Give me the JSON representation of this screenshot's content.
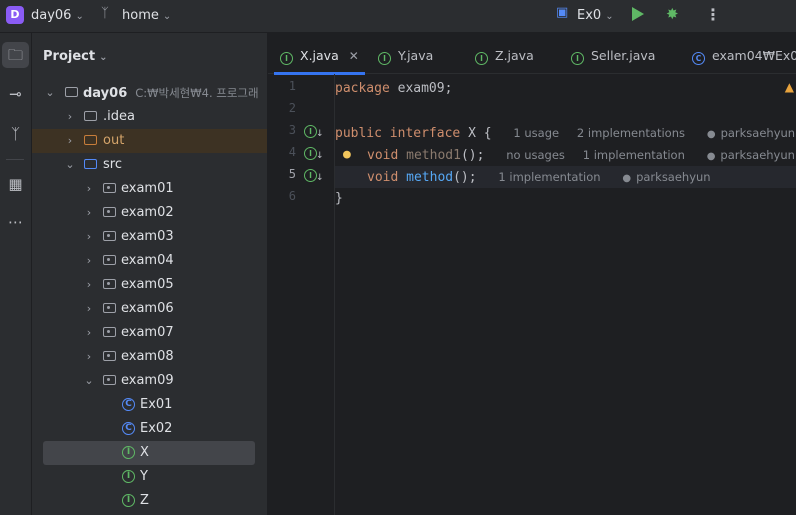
{
  "titlebar": {
    "project_badge": "D",
    "project_name": "day06",
    "branch": "home",
    "run_config": "Ex0"
  },
  "project_panel": {
    "title": "Project",
    "root": {
      "label": "day06",
      "path": "C:₩박세현₩4. 프로그래"
    },
    "items": [
      {
        "label": ".idea"
      },
      {
        "label": "out"
      },
      {
        "label": "src"
      },
      {
        "label": "exam01"
      },
      {
        "label": "exam02"
      },
      {
        "label": "exam03"
      },
      {
        "label": "exam04"
      },
      {
        "label": "exam05"
      },
      {
        "label": "exam06"
      },
      {
        "label": "exam07"
      },
      {
        "label": "exam08"
      },
      {
        "label": "exam09"
      },
      {
        "label": "Ex01"
      },
      {
        "label": "Ex02"
      },
      {
        "label": "X"
      },
      {
        "label": "Y"
      },
      {
        "label": "Z"
      }
    ]
  },
  "tabs": [
    {
      "label": "X.java",
      "active": true
    },
    {
      "label": "Y.java"
    },
    {
      "label": "Z.java"
    },
    {
      "label": "Seller.java"
    },
    {
      "label": "exam04₩Ex0"
    }
  ],
  "editor": {
    "line_numbers": [
      "1",
      "2",
      "3",
      "4",
      "5",
      "6"
    ],
    "line1": {
      "kw": "package",
      "rest": " exam09;"
    },
    "line3": {
      "kw1": "public",
      "kw2": "interface",
      "rest": " X {",
      "usages": "1 usage",
      "impls": "2 implementations",
      "author": "parksaehyun"
    },
    "line4": {
      "kw": "void",
      "method": "method1",
      "rest": "();",
      "usages": "no usages",
      "impls": "1 implementation",
      "author": "parksaehyun"
    },
    "line5": {
      "kw": "void",
      "method": "method",
      "rest": "();",
      "impls": "1 implementation",
      "author": "parksaehyun"
    },
    "line6": {
      "text": "}"
    }
  }
}
